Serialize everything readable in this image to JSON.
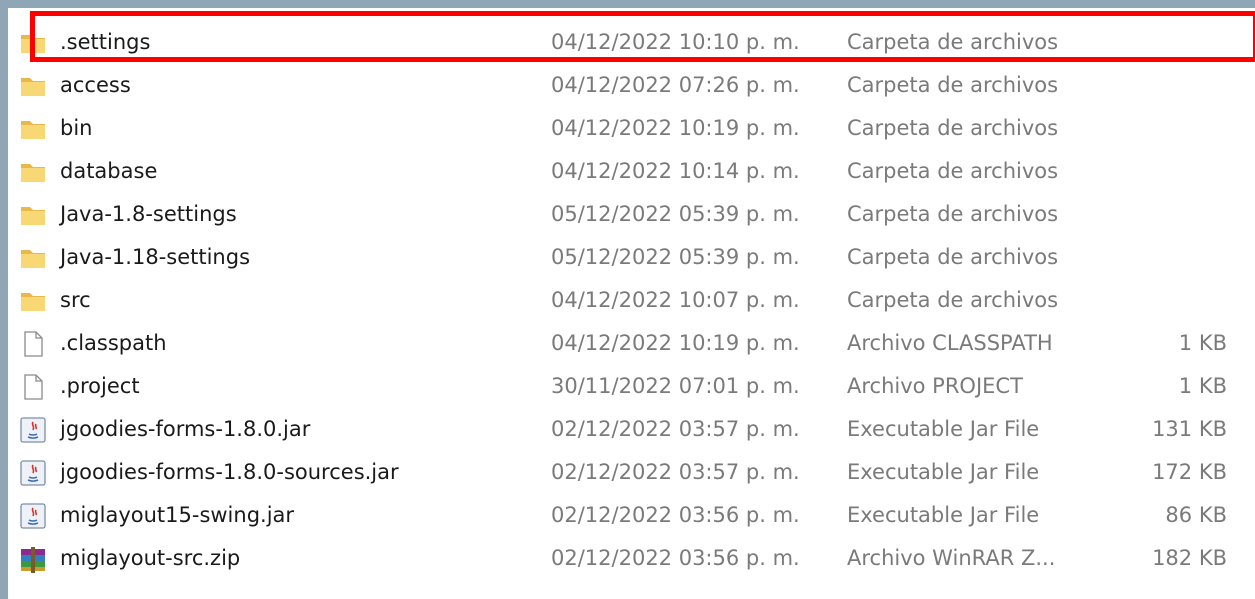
{
  "files": [
    {
      "name": ".settings",
      "date": "04/12/2022 10:10 p. m.",
      "type": "Carpeta de archivos",
      "size": "",
      "icon": "folder-icon"
    },
    {
      "name": "access",
      "date": "04/12/2022 07:26 p. m.",
      "type": "Carpeta de archivos",
      "size": "",
      "icon": "folder-icon"
    },
    {
      "name": "bin",
      "date": "04/12/2022 10:19 p. m.",
      "type": "Carpeta de archivos",
      "size": "",
      "icon": "folder-icon"
    },
    {
      "name": "database",
      "date": "04/12/2022 10:14 p. m.",
      "type": "Carpeta de archivos",
      "size": "",
      "icon": "folder-icon"
    },
    {
      "name": "Java-1.8-settings",
      "date": "05/12/2022 05:39 p. m.",
      "type": "Carpeta de archivos",
      "size": "",
      "icon": "folder-icon"
    },
    {
      "name": "Java-1.18-settings",
      "date": "05/12/2022 05:39 p. m.",
      "type": "Carpeta de archivos",
      "size": "",
      "icon": "folder-icon"
    },
    {
      "name": "src",
      "date": "04/12/2022 10:07 p. m.",
      "type": "Carpeta de archivos",
      "size": "",
      "icon": "folder-icon"
    },
    {
      "name": ".classpath",
      "date": "04/12/2022 10:19 p. m.",
      "type": "Archivo CLASSPATH",
      "size": "1 KB",
      "icon": "document-icon"
    },
    {
      "name": ".project",
      "date": "30/11/2022 07:01 p. m.",
      "type": "Archivo PROJECT",
      "size": "1 KB",
      "icon": "document-icon"
    },
    {
      "name": "jgoodies-forms-1.8.0.jar",
      "date": "02/12/2022 03:57 p. m.",
      "type": "Executable Jar File",
      "size": "131 KB",
      "icon": "java-jar-icon"
    },
    {
      "name": "jgoodies-forms-1.8.0-sources.jar",
      "date": "02/12/2022 03:57 p. m.",
      "type": "Executable Jar File",
      "size": "172 KB",
      "icon": "java-jar-icon"
    },
    {
      "name": "miglayout15-swing.jar",
      "date": "02/12/2022 03:56 p. m.",
      "type": "Executable Jar File",
      "size": "86 KB",
      "icon": "java-jar-icon"
    },
    {
      "name": "miglayout-src.zip",
      "date": "02/12/2022 03:56 p. m.",
      "type": "Archivo WinRAR Z...",
      "size": "182 KB",
      "icon": "winrar-archive-icon"
    }
  ],
  "highlighted_row": 0,
  "colors": {
    "highlight_border": "#ff0000",
    "folder": "#f8d775",
    "text_primary": "#1a1a1a",
    "text_secondary": "#7a7a7a"
  }
}
